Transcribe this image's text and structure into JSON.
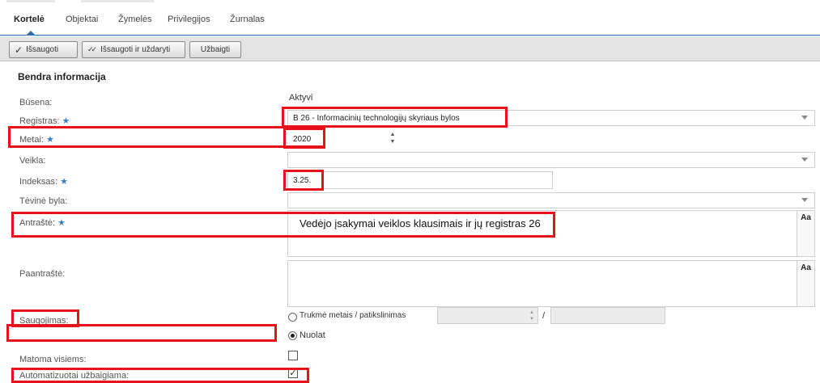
{
  "tabs": [
    {
      "label": "Kortelė",
      "active": true
    },
    {
      "label": "Objektai",
      "active": false
    },
    {
      "label": "Žymelės",
      "active": false
    },
    {
      "label": "Privilegijos",
      "active": false
    },
    {
      "label": "Žurnalas",
      "active": false
    }
  ],
  "toolbar": {
    "save_label": "Išsaugoti",
    "save_close_label": "Išsaugoti ir uždaryti",
    "finish_label": "Užbaigti"
  },
  "section_title": "Bendra informacija",
  "form": {
    "status": {
      "label": "Būsena:",
      "value": "Aktyvi"
    },
    "registry": {
      "label": "Registras:",
      "value": "B 26 - Informacinių technologijų skyriaus bylos"
    },
    "year": {
      "label": "Metai:",
      "value": "2020"
    },
    "activity": {
      "label": "Veikla:",
      "value": ""
    },
    "index": {
      "label": "Indeksas:",
      "value": "3.25."
    },
    "parent_file": {
      "label": "Tėvinė byla:",
      "value": ""
    },
    "title": {
      "label": "Antraštė:",
      "value": "Vedėjo įsakymai veiklos klausimais ir jų registras 26"
    },
    "subtitle": {
      "label": "Paantraštė:",
      "value": ""
    },
    "retention": {
      "label": "Saugojimas:",
      "option_term": "Trukmė metais / patikslinimas",
      "option_permanent": "Nuolat",
      "separator": "/",
      "selected": "Nuolat"
    },
    "visible_all": {
      "label": "Matoma visiems:",
      "checked": false
    },
    "auto_complete": {
      "label": "Automatizuotai užbaigiama:",
      "checked": true
    }
  },
  "icons": {
    "required": "★",
    "check": "✓",
    "double_check": "✓✓",
    "rich_text": "Aa"
  },
  "colors": {
    "accent": "#2b6ea8",
    "required": "#3b7fc4",
    "highlight": "#e8121b"
  }
}
